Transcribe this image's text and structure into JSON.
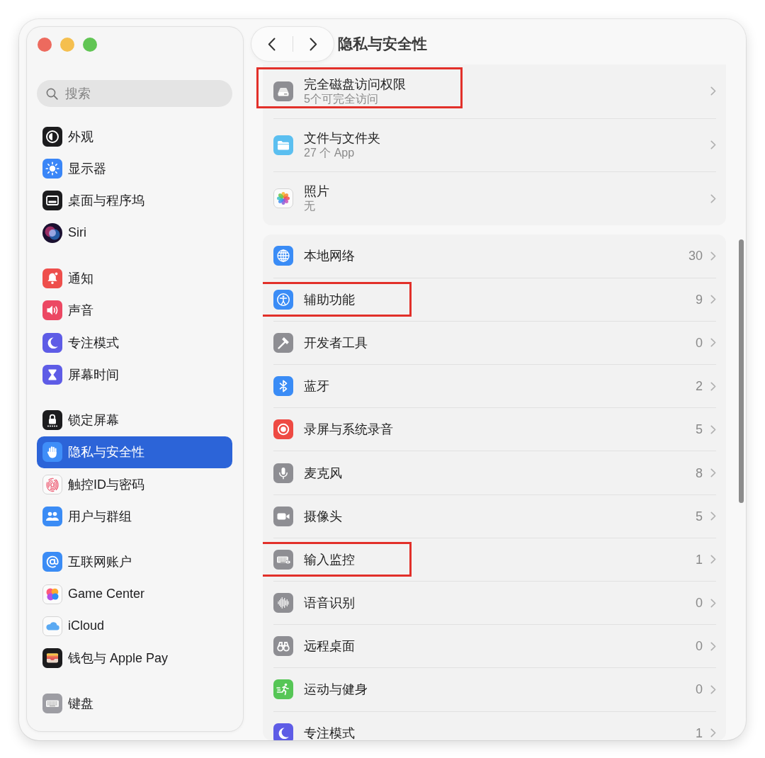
{
  "sidebar": {
    "search": {
      "placeholder": "搜索"
    },
    "groups": [
      {
        "items": [
          {
            "label": "外观",
            "selected": false
          },
          {
            "label": "显示器",
            "selected": false
          },
          {
            "label": "桌面与程序坞",
            "selected": false
          },
          {
            "label": "Siri",
            "selected": false
          }
        ]
      },
      {
        "items": [
          {
            "label": "通知",
            "selected": false
          },
          {
            "label": "声音",
            "selected": false
          },
          {
            "label": "专注模式",
            "selected": false
          },
          {
            "label": "屏幕时间",
            "selected": false
          }
        ]
      },
      {
        "items": [
          {
            "label": "锁定屏幕",
            "selected": false
          },
          {
            "label": "隐私与安全性",
            "selected": true
          },
          {
            "label": "触控ID与密码",
            "selected": false
          },
          {
            "label": "用户与群组",
            "selected": false
          }
        ]
      },
      {
        "items": [
          {
            "label": "互联网账户",
            "selected": false
          },
          {
            "label": "Game Center",
            "selected": false
          },
          {
            "label": "iCloud",
            "selected": false
          },
          {
            "label": "钱包与 Apple Pay",
            "selected": false
          }
        ]
      },
      {
        "items": [
          {
            "label": "键盘",
            "selected": false
          }
        ]
      }
    ]
  },
  "toolbar": {
    "title": "隐私与安全性"
  },
  "sections": [
    {
      "rows": [
        {
          "title": "完全磁盘访问权限",
          "subtitle": "5个可完全访问",
          "highlighted": true
        },
        {
          "title": "文件与文件夹",
          "subtitle": "27 个 App",
          "highlighted": false
        },
        {
          "title": "照片",
          "subtitle": "无",
          "highlighted": false
        }
      ]
    },
    {
      "rows": [
        {
          "title": "本地网络",
          "count": "30",
          "highlighted": false
        },
        {
          "title": "辅助功能",
          "count": "9",
          "highlighted": true
        },
        {
          "title": "开发者工具",
          "count": "0",
          "highlighted": false
        },
        {
          "title": "蓝牙",
          "count": "2",
          "highlighted": false
        },
        {
          "title": "录屏与系统录音",
          "count": "5",
          "highlighted": false
        },
        {
          "title": "麦克风",
          "count": "8",
          "highlighted": false
        },
        {
          "title": "摄像头",
          "count": "5",
          "highlighted": false
        },
        {
          "title": "输入监控",
          "count": "1",
          "highlighted": true
        },
        {
          "title": "语音识别",
          "count": "0",
          "highlighted": false
        },
        {
          "title": "远程桌面",
          "count": "0",
          "highlighted": false
        },
        {
          "title": "运动与健身",
          "count": "0",
          "highlighted": false
        },
        {
          "title": "专注模式",
          "count": "1",
          "highlighted": false
        }
      ]
    }
  ]
}
